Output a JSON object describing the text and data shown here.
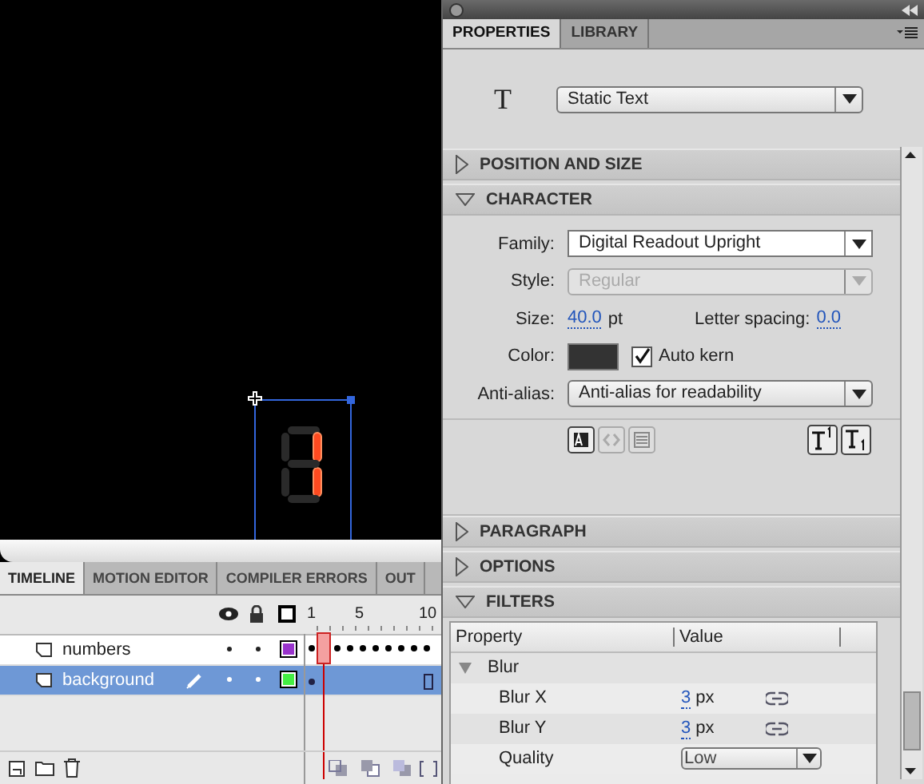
{
  "properties_panel": {
    "tabs": [
      {
        "label": "PROPERTIES",
        "selected": true
      },
      {
        "label": "LIBRARY",
        "selected": false
      }
    ],
    "text_tool_glyph": "T",
    "text_type": "Static Text",
    "sections": [
      {
        "kind": "position",
        "title": "POSITION AND SIZE",
        "expanded": false
      },
      {
        "kind": "character",
        "title": "CHARACTER",
        "expanded": true
      },
      {
        "kind": "paragraph",
        "title": "PARAGRAPH",
        "expanded": false
      },
      {
        "kind": "options",
        "title": "OPTIONS",
        "expanded": false
      },
      {
        "kind": "filters",
        "title": "FILTERS",
        "expanded": true
      }
    ],
    "character": {
      "family_label": "Family:",
      "family": "Digital Readout Upright",
      "style_label": "Style:",
      "style": "Regular",
      "style_disabled": true,
      "size_label": "Size:",
      "size": "40.0",
      "size_unit": "pt",
      "letter_spacing_label": "Letter spacing:",
      "letter_spacing": "0.0",
      "color_label": "Color:",
      "auto_kern_label": "Auto kern",
      "auto_kern": true,
      "anti_alias_label": "Anti-alias:",
      "anti_alias": "Anti-alias for readability"
    },
    "filters": {
      "columns": [
        "Property",
        "Value"
      ],
      "group": {
        "name": "Blur",
        "expanded": true
      },
      "rows": [
        {
          "kind": "number",
          "label": "Blur X",
          "value": "3",
          "unit": "px"
        },
        {
          "kind": "number",
          "label": "Blur Y",
          "value": "3",
          "unit": "px"
        },
        {
          "kind": "dropdown",
          "label": "Quality",
          "value": "Low"
        }
      ]
    }
  },
  "timeline": {
    "tabs": [
      {
        "label": "TIMELINE",
        "selected": true
      },
      {
        "label": "MOTION EDITOR",
        "selected": false
      },
      {
        "label": "COMPILER ERRORS",
        "selected": false
      },
      {
        "label": "OUT",
        "selected": false
      }
    ],
    "frame_numbers": [
      "1",
      "5",
      "10"
    ],
    "layers": [
      {
        "name": "numbers",
        "selected": false,
        "color": "#9933cc"
      },
      {
        "name": "background",
        "selected": true,
        "color": "#44ee44"
      }
    ]
  }
}
